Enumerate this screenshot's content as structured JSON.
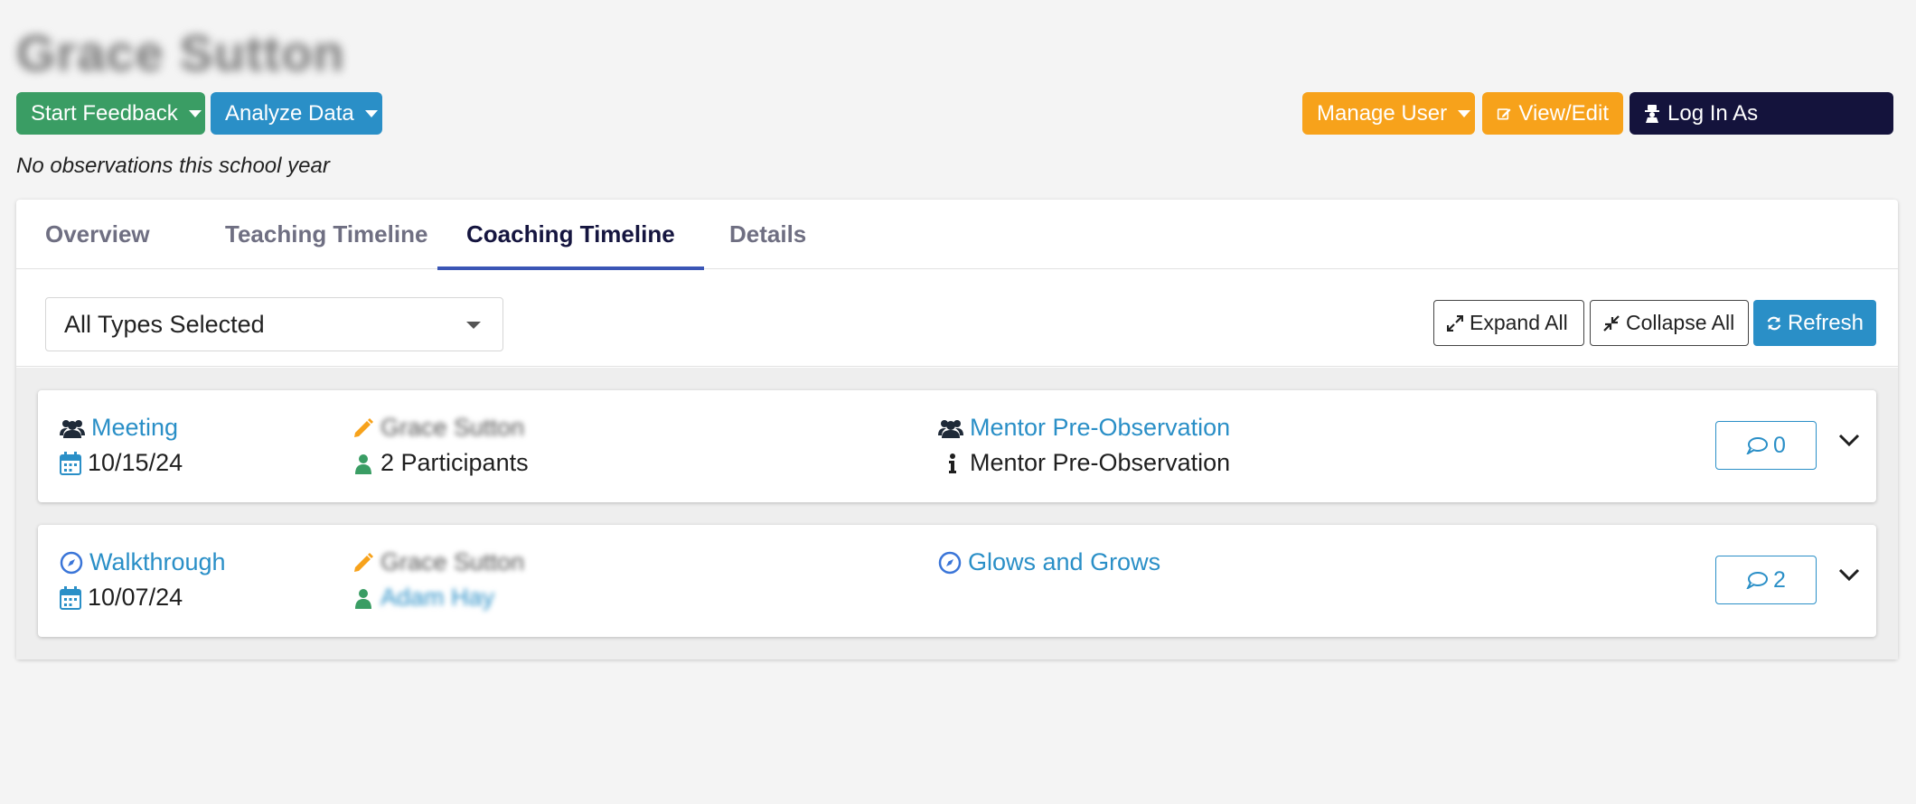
{
  "user": {
    "name": "Grace Sutton"
  },
  "actions": {
    "start_feedback": "Start Feedback",
    "analyze_data": "Analyze Data",
    "manage_user": "Manage User",
    "view_edit": "View/Edit",
    "log_in_as": "Log In As"
  },
  "status_note": "No observations this school year",
  "tabs": [
    {
      "label": "Overview",
      "active": false
    },
    {
      "label": "Teaching Timeline",
      "active": false
    },
    {
      "label": "Coaching Timeline",
      "active": true
    },
    {
      "label": "Details",
      "active": false
    }
  ],
  "filter": {
    "selected": "All Types Selected"
  },
  "toolbar": {
    "expand_all": "Expand All",
    "collapse_all": "Collapse All",
    "refresh": "Refresh"
  },
  "items": [
    {
      "type": "Meeting",
      "type_icon": "users-icon",
      "date": "10/15/24",
      "author": "Grace Sutton",
      "participants": "2 Participants",
      "form": "Mentor Pre-Observation",
      "info": "Mentor Pre-Observation",
      "comments": "0"
    },
    {
      "type": "Walkthrough",
      "type_icon": "compass-icon",
      "date": "10/07/24",
      "author": "Grace Sutton",
      "participant_name": "Adam Hay",
      "form": "Glows and Grows",
      "comments": "2"
    }
  ],
  "colors": {
    "green": "#3a9d64",
    "blue": "#2a8fc7",
    "orange": "#f7a21b",
    "navy": "#14133c",
    "tab_underline": "#3a55b5"
  }
}
